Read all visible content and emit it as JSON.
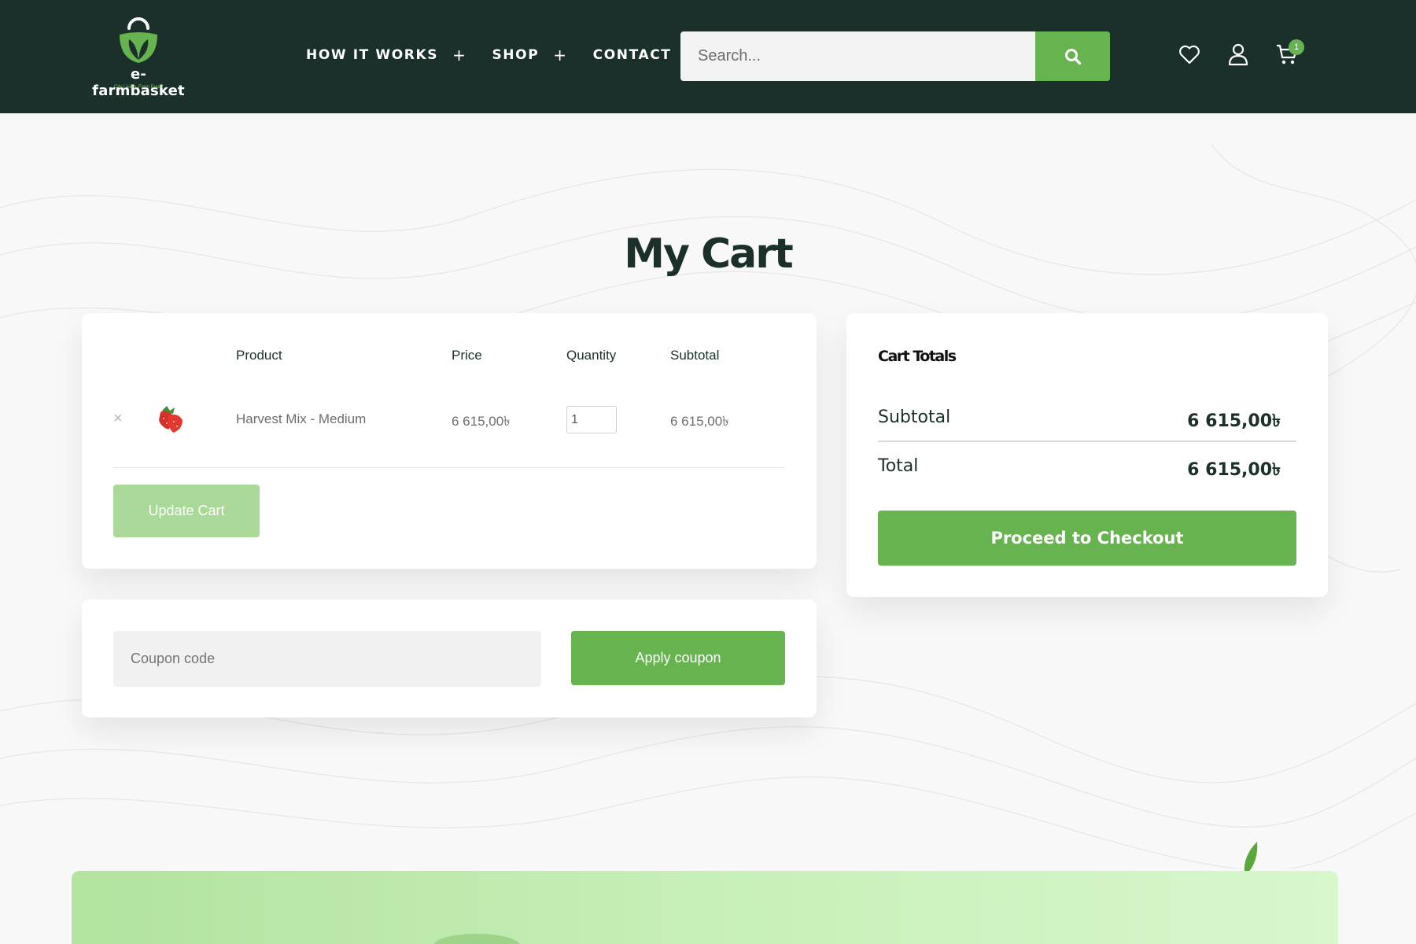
{
  "header": {
    "logo": {
      "name": "e-farmbasket",
      "tagline": "City Living, Farm Fresh"
    },
    "nav": [
      {
        "label": "HOW IT WORKS",
        "has_submenu": true,
        "toggle": "+"
      },
      {
        "label": "SHOP",
        "has_submenu": true,
        "toggle": "+"
      },
      {
        "label": "CONTACT",
        "has_submenu": false
      }
    ],
    "search": {
      "placeholder": "Search...",
      "icon": "search-icon"
    },
    "icons": {
      "wishlist": "heart-icon",
      "account": "user-icon",
      "cart": "cart-icon"
    },
    "cart_count": "1"
  },
  "page": {
    "title": "My Cart"
  },
  "cart": {
    "columns": [
      "Product",
      "Price",
      "Quantity",
      "Subtotal"
    ],
    "items": [
      {
        "remove_icon": "×",
        "thumbnail": "strawberry-icon",
        "product": "Harvest Mix - Medium",
        "price": "6 615,00৳",
        "quantity": "1",
        "subtotal": "6 615,00৳"
      }
    ],
    "update_label": "Update Cart"
  },
  "coupon": {
    "placeholder": "Coupon code",
    "apply_label": "Apply coupon"
  },
  "totals": {
    "title": "Cart Totals",
    "subtotal_label": "Subtotal",
    "subtotal_value": "6 615,00৳",
    "total_label": "Total",
    "total_value": "6 615,00৳",
    "checkout_label": "Proceed to Checkout"
  },
  "colors": {
    "header_bg": "#1b2f2b",
    "accent_green": "#66b34f",
    "disabled_green": "#a9d899",
    "page_bg": "#f7f8f7"
  }
}
